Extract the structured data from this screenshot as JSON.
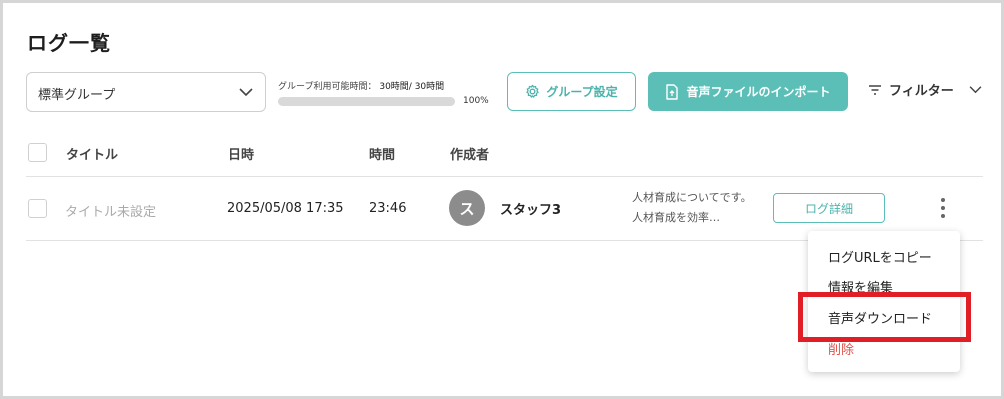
{
  "page": {
    "title": "ログ一覧"
  },
  "toolbar": {
    "group_select_value": "標準グループ",
    "usage_label": "グループ利用可能時間：",
    "usage_value": "30時間/ 30時間",
    "usage_percent_text": "100%",
    "usage_fraction": 1.0,
    "group_settings_label": "グループ設定",
    "import_label": "音声ファイルのインポート",
    "filter_label": "フィルター"
  },
  "table": {
    "headers": {
      "title": "タイトル",
      "datetime": "日時",
      "duration": "時間",
      "creator": "作成者"
    },
    "rows": [
      {
        "title": "タイトル未設定",
        "datetime": "2025/05/08 17:35",
        "duration": "23:46",
        "avatar_initial": "ス",
        "creator": "スタッフ3",
        "summary": "人材育成についてです。人材育成を効率…",
        "detail_label": "ログ詳細"
      }
    ]
  },
  "context_menu": {
    "items": [
      "ログURLをコピー",
      "情報を編集",
      "音声ダウンロード",
      "削除"
    ]
  },
  "colors": {
    "accent": "#5bbfb8",
    "danger": "#e0524d",
    "highlight": "#e11d25"
  }
}
